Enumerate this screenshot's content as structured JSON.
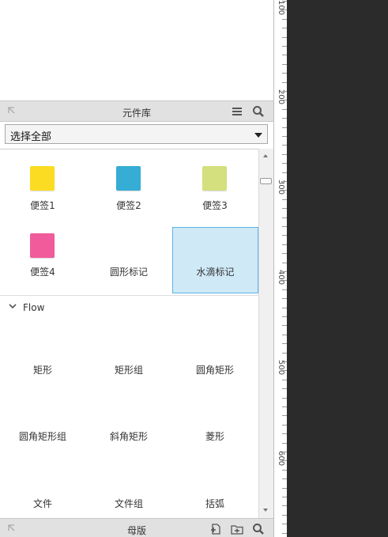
{
  "component_library": {
    "title": "元件库",
    "menu_icon": "menu-icon",
    "search_icon": "search-icon",
    "collapse_icon": "collapse-arrow-icon",
    "filter": {
      "selected": "选择全部"
    },
    "widgets_group1": [
      {
        "label": "便签1",
        "color": "#fcdc23"
      },
      {
        "label": "便签2",
        "color": "#35add4"
      },
      {
        "label": "便签3",
        "color": "#d4e07e"
      },
      {
        "label": "便签4",
        "color": "#f15b9c"
      },
      {
        "label": "圆形标记"
      },
      {
        "label": "水滴标记",
        "selected": true
      }
    ],
    "flow_section": {
      "label": "Flow",
      "expanded": true
    },
    "flow_items": [
      "矩形",
      "矩形组",
      "圆角矩形",
      "圆角矩形组",
      "斜角矩形",
      "菱形",
      "文件",
      "文件组",
      "括弧"
    ]
  },
  "masters": {
    "title": "母版",
    "icons": [
      "add-master-icon",
      "add-folder-icon",
      "search-icon"
    ]
  },
  "ruler": {
    "labels": [
      "100",
      "200",
      "300",
      "400",
      "500",
      "600"
    ]
  },
  "colors": {
    "selected_bg": "#cfe9f7",
    "selected_border": "#5cb3e6",
    "header_bg": "#e1e1e1",
    "canvas_dark": "#2b2b2b"
  }
}
